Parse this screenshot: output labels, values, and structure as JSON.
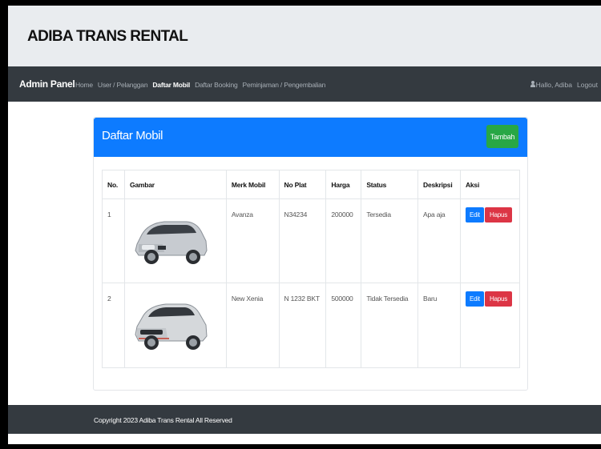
{
  "brand": {
    "title": "ADIBA TRANS RENTAL"
  },
  "navbar": {
    "brand": "Admin Panel",
    "links": [
      "Home",
      "User / Pelanggan",
      "Daftar Mobil",
      "Daftar Booking",
      "Peminjaman / Pengembalian"
    ],
    "active_link": "Daftar Mobil",
    "user_greeting": "Hallo, Adiba",
    "logout": "Logout",
    "user_icon": "user-icon"
  },
  "card": {
    "title": "Daftar Mobil",
    "add_button": "Tambah",
    "header_color": "#0d7bff"
  },
  "table": {
    "columns": [
      "No.",
      "Gambar",
      "Merk Mobil",
      "No Plat",
      "Harga",
      "Status",
      "Deskripsi",
      "Aksi"
    ],
    "rows": [
      {
        "no": "1",
        "image": "silver-avanza-car",
        "merk": "Avanza",
        "plat": "N34234",
        "harga": "200000",
        "status": "Tersedia",
        "deskripsi": "Apa aja",
        "edit": "Edit",
        "hapus": "Hapus"
      },
      {
        "no": "2",
        "image": "silver-xenia-car",
        "merk": "New Xenia",
        "plat": "N 1232 BKT",
        "harga": "500000",
        "status": "Tidak Tersedia",
        "deskripsi": "Baru",
        "edit": "Edit",
        "hapus": "Hapus"
      }
    ]
  },
  "footer": {
    "text": "Copyright 2023 Adiba Trans Rental All Reserved"
  },
  "colors": {
    "navbar": "#343a40",
    "primary": "#0d7bff",
    "success": "#28a745",
    "danger": "#dc3545"
  }
}
